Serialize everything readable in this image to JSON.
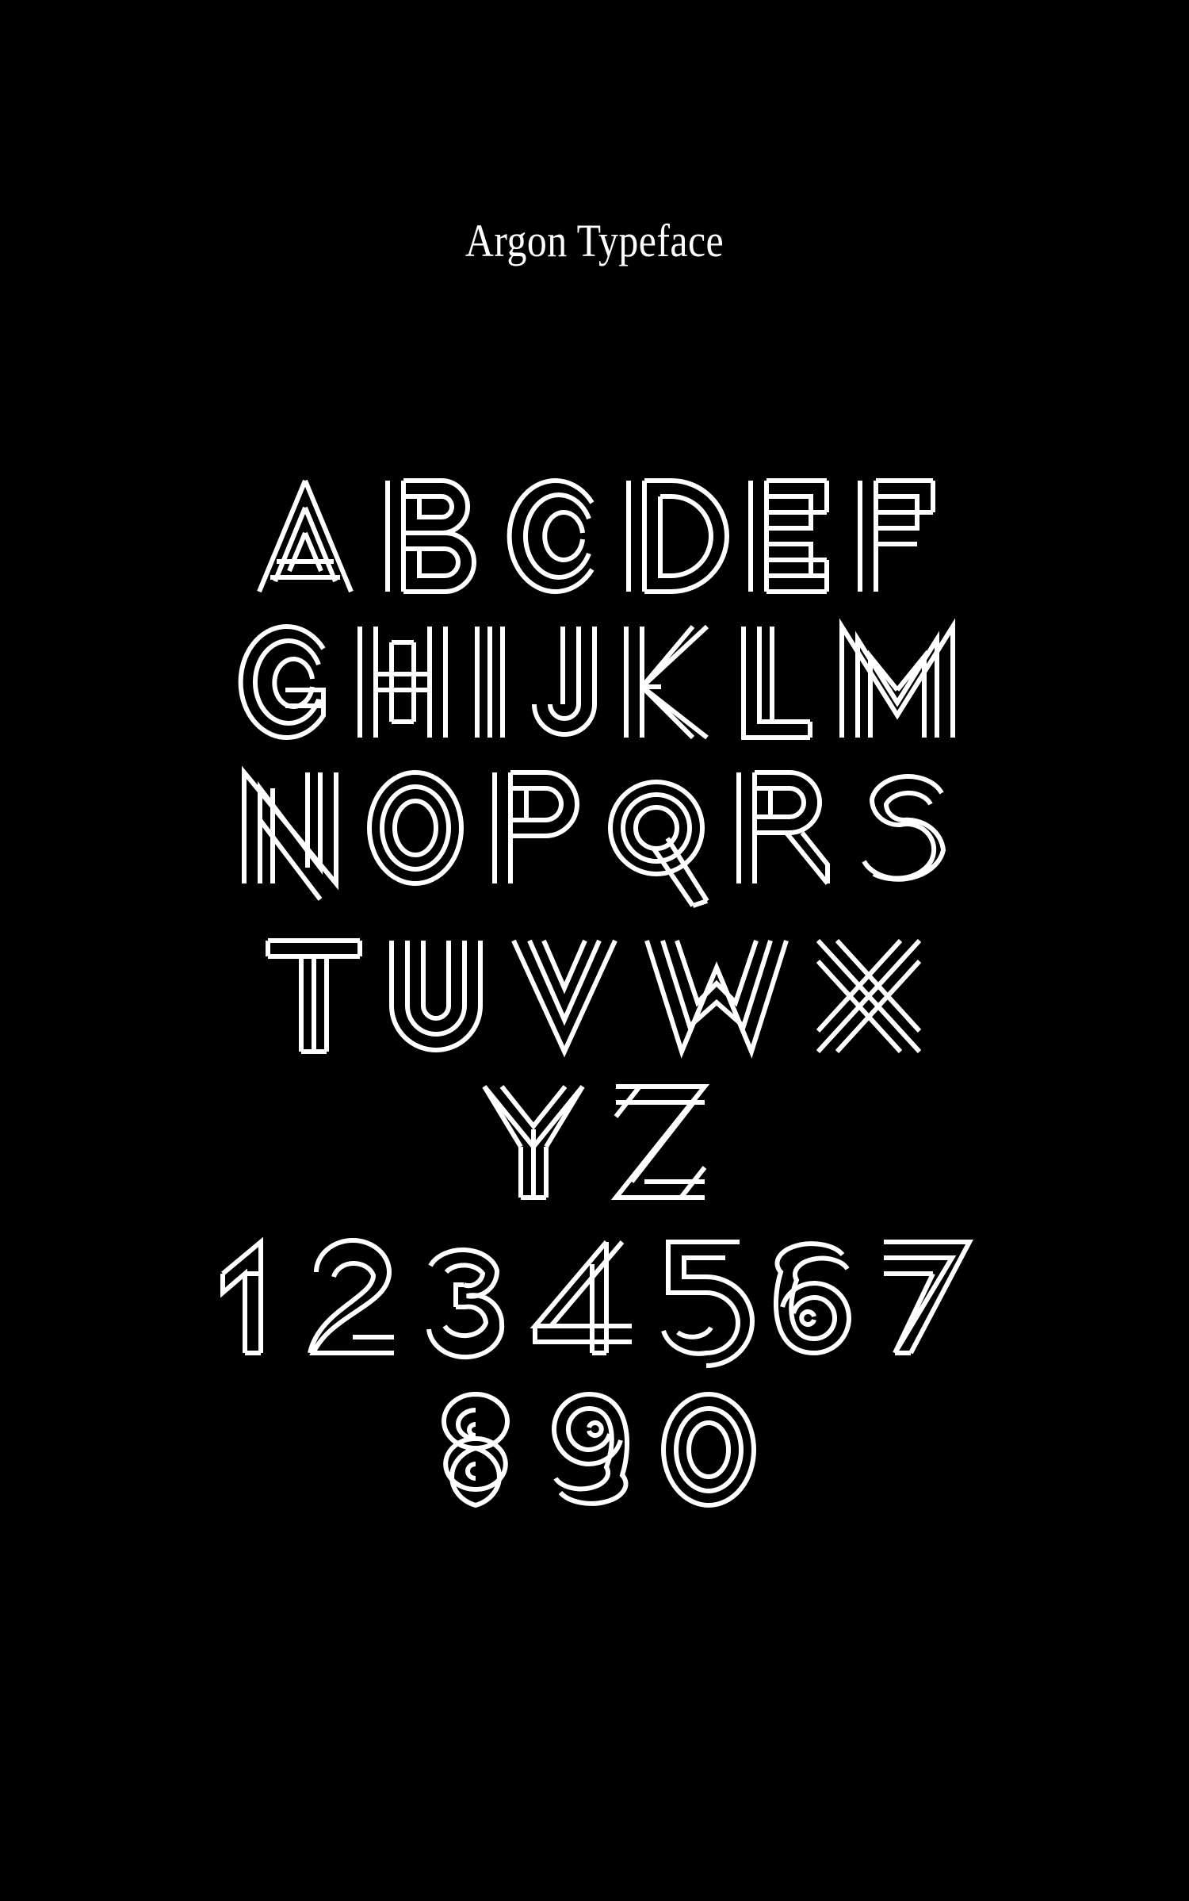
{
  "poster": {
    "title": "Argon Typeface",
    "background_color": "#000000",
    "ink_color": "#ffffff",
    "style": "inline-striped-display-letterforms"
  },
  "specimen": {
    "rows": [
      {
        "id": "row-uppercase-1",
        "glyphs": [
          "A",
          "B",
          "C",
          "D",
          "E",
          "F"
        ]
      },
      {
        "id": "row-uppercase-2",
        "glyphs": [
          "G",
          "H",
          "I",
          "J",
          "K",
          "L",
          "M"
        ]
      },
      {
        "id": "row-uppercase-3",
        "glyphs": [
          "N",
          "O",
          "P",
          "Q",
          "R",
          "S"
        ]
      },
      {
        "id": "row-uppercase-4",
        "glyphs": [
          "T",
          "U",
          "V",
          "W",
          "X"
        ]
      },
      {
        "id": "row-uppercase-5",
        "glyphs": [
          "Y",
          "Z"
        ]
      },
      {
        "id": "row-numerals-1",
        "glyphs": [
          "1",
          "2",
          "3",
          "4",
          "5",
          "6",
          "7"
        ]
      },
      {
        "id": "row-numerals-2",
        "glyphs": [
          "8",
          "9",
          "0"
        ]
      }
    ],
    "uppercase_set": "ABCDEFGHIJKLMNOPQRSTUVWXYZ",
    "numeral_set": "1234567890"
  }
}
